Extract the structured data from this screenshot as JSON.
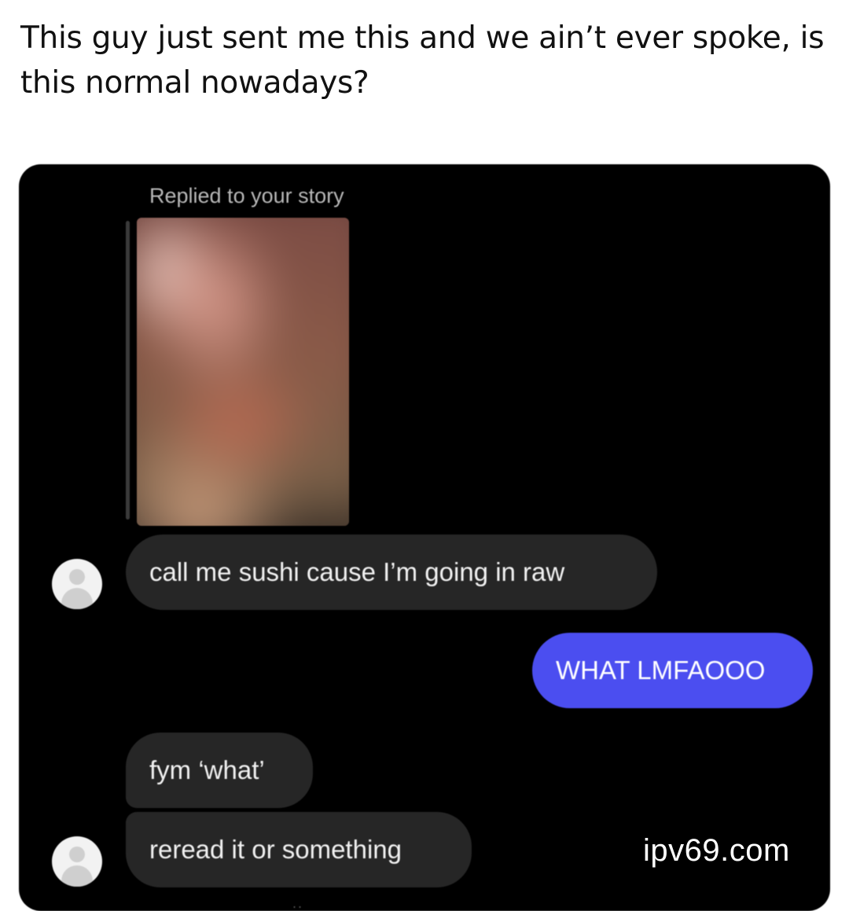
{
  "post": {
    "caption": "This guy just sent me this and we ain’t ever spoke, is this normal nowadays?"
  },
  "chat": {
    "story_reply_label": "Replied to your story",
    "messages": [
      {
        "sender": "them",
        "text": "call me sushi cause I’m going in raw"
      },
      {
        "sender": "me",
        "text": "WHAT LMFAOOO"
      },
      {
        "sender": "them",
        "text": "fym ‘what’"
      },
      {
        "sender": "them",
        "text": "reread it or something"
      }
    ],
    "typing_indicator": "..",
    "colors": {
      "background": "#000000",
      "incoming_bubble": "#262626",
      "outgoing_bubble": "#4b4ef0"
    }
  },
  "watermark": "ipv69.com"
}
